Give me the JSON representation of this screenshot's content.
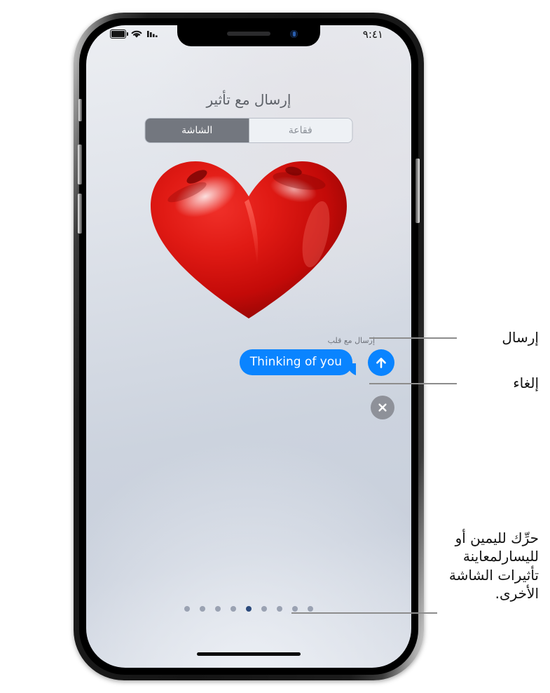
{
  "status_bar": {
    "time": "٩:٤١",
    "icons": [
      "battery-icon",
      "wifi-icon",
      "cellular-signal-icon"
    ]
  },
  "screen": {
    "title": "إرسال مع تأثير",
    "tabs": [
      {
        "label": "الشاشة",
        "selected": true
      },
      {
        "label": "فقاعة",
        "selected": false
      }
    ],
    "effect_preview": {
      "name": "heart-balloon-effect",
      "caption": "إرسال مع قلب"
    },
    "message_bubble": {
      "text": "Thinking of you",
      "color": "#0a84ff"
    },
    "send_button": {
      "name": "send-button",
      "color": "#0a84ff"
    },
    "cancel_button": {
      "name": "cancel-button",
      "color": "#8e9199"
    },
    "page_dots": {
      "count": 9,
      "active_index": 4,
      "active_color": "#2c4a7c",
      "inactive_color": "#9aa2b2"
    }
  },
  "callouts": [
    {
      "label": "إرسال",
      "target": "send-button"
    },
    {
      "label": "إلغاء",
      "target": "cancel-button"
    },
    {
      "lines": [
        "حرِّك لليمين أو",
        "لليسارلمعاينة",
        "تأثيرات الشاشة",
        "الأخرى."
      ],
      "target": "page-dots"
    }
  ]
}
